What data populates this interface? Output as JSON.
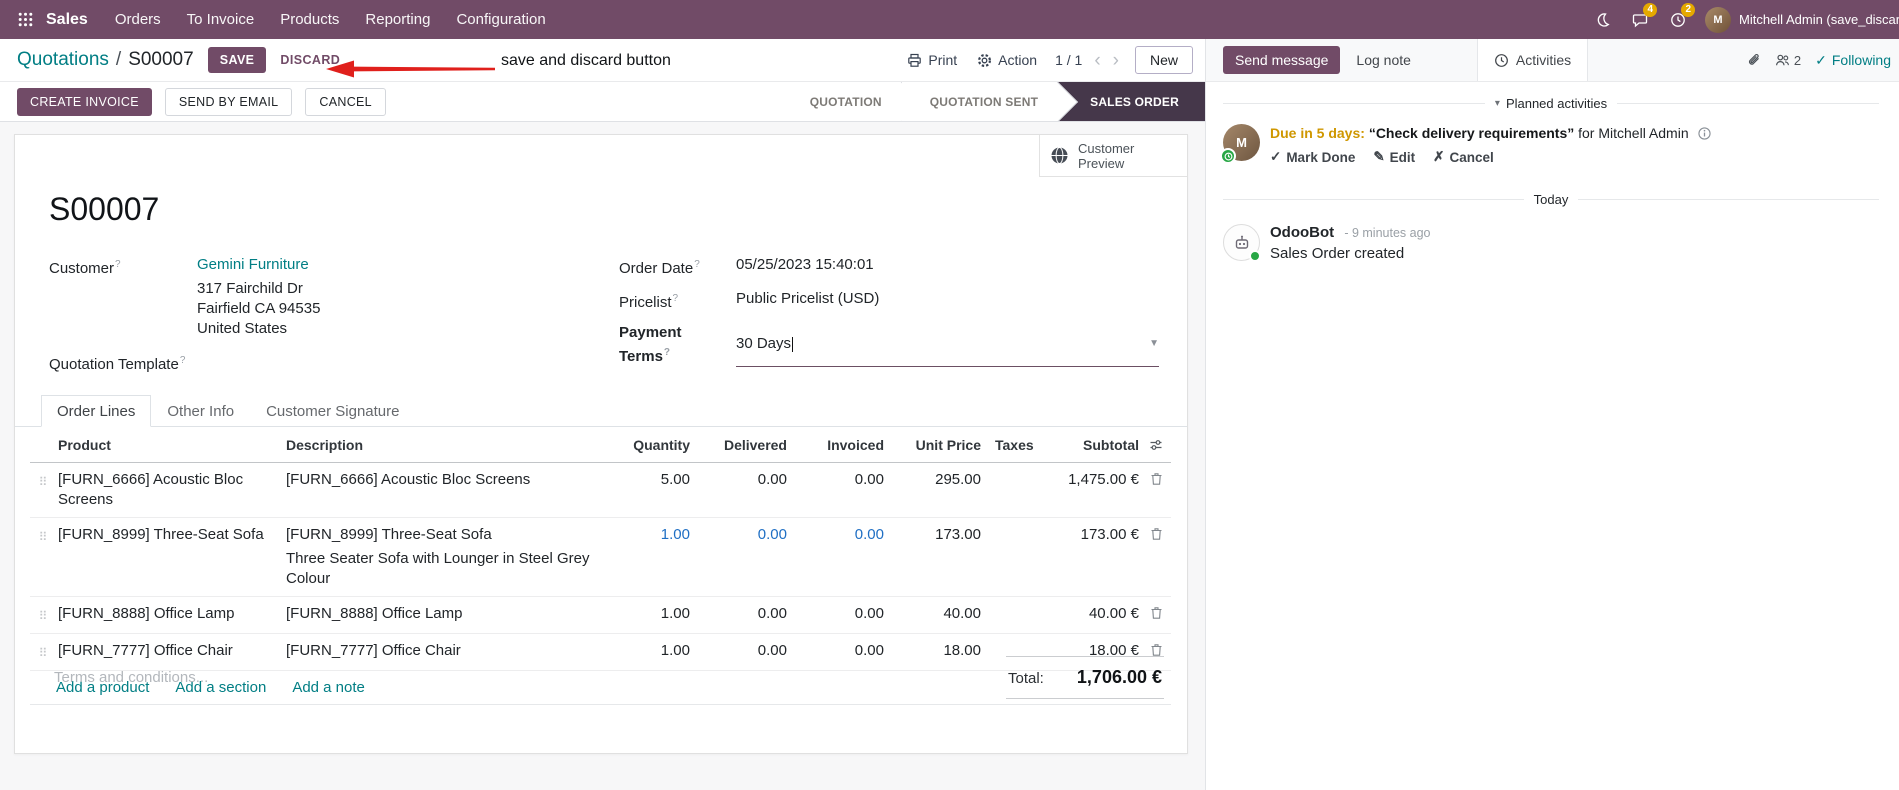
{
  "colors": {
    "primary": "#714B67",
    "link": "#017E84",
    "edited_value": "#1F6FC4",
    "stage_active_bg": "#45374A",
    "nav_badge": "#E4A900",
    "annotation_red": "#E0201C",
    "activity_due": "#CF9700",
    "online_green": "#28A745"
  },
  "icons": {
    "caret_down": "▾",
    "dropdown_arrow": "▼",
    "pager_prev": "‹",
    "pager_next": "›",
    "check": "✓",
    "pencil": "✎",
    "x_mark": "✗",
    "drag_handle": "⠿",
    "help_marker": "?"
  },
  "nav": {
    "app": "Sales",
    "menus": [
      "Orders",
      "To Invoice",
      "Products",
      "Reporting",
      "Configuration"
    ],
    "messages_badge": "4",
    "activities_badge": "2",
    "user_initial": "M",
    "user": "Mitchell Admin (save_discar"
  },
  "control": {
    "breadcrumb_parent": "Quotations",
    "breadcrumb_sep": "/",
    "breadcrumb_current": "S00007",
    "save": "SAVE",
    "discard": "DISCARD",
    "annotation": "save and discard button",
    "print": "Print",
    "action": "Action",
    "pager": "1 / 1",
    "new": "New"
  },
  "statusbar": {
    "create_invoice": "CREATE INVOICE",
    "send_by_email": "SEND BY EMAIL",
    "cancel": "CANCEL",
    "stages": [
      "QUOTATION",
      "QUOTATION SENT",
      "SALES ORDER"
    ],
    "active_stage": "SALES ORDER"
  },
  "sheet": {
    "customer_preview": "Customer Preview",
    "title": "S00007",
    "customer_label": "Customer",
    "customer_name": "Gemini Furniture",
    "address_line1": "317 Fairchild Dr",
    "address_line2": "Fairfield CA 94535",
    "address_line3": "United States",
    "quotation_template_label": "Quotation Template",
    "order_date_label": "Order Date",
    "order_date": "05/25/2023 15:40:01",
    "pricelist_label": "Pricelist",
    "pricelist": "Public Pricelist (USD)",
    "payment_terms_label": "Payment Terms",
    "payment_terms": "30 Days",
    "tabs": [
      "Order Lines",
      "Other Info",
      "Customer Signature"
    ]
  },
  "order_lines": {
    "columns": [
      "Product",
      "Description",
      "Quantity",
      "Delivered",
      "Invoiced",
      "Unit Price",
      "Taxes",
      "Subtotal"
    ],
    "rows": [
      {
        "product": "[FURN_6666] Acoustic Bloc Screens",
        "description": "[FURN_6666] Acoustic Bloc Screens",
        "description2": "",
        "quantity": "5.00",
        "delivered": "0.00",
        "invoiced": "0.00",
        "unit_price": "295.00",
        "taxes": "",
        "subtotal": "1,475.00 €"
      },
      {
        "product": "[FURN_8999] Three-Seat Sofa",
        "description": "[FURN_8999] Three-Seat Sofa",
        "description2": "Three Seater Sofa with Lounger in Steel Grey Colour",
        "quantity": "1.00",
        "delivered": "0.00",
        "invoiced": "0.00",
        "unit_price": "173.00",
        "taxes": "",
        "subtotal": "173.00 €"
      },
      {
        "product": "[FURN_8888] Office Lamp",
        "description": "[FURN_8888] Office Lamp",
        "description2": "",
        "quantity": "1.00",
        "delivered": "0.00",
        "invoiced": "0.00",
        "unit_price": "40.00",
        "taxes": "",
        "subtotal": "40.00 €"
      },
      {
        "product": "[FURN_7777] Office Chair",
        "description": "[FURN_7777] Office Chair",
        "description2": "",
        "quantity": "1.00",
        "delivered": "0.00",
        "invoiced": "0.00",
        "unit_price": "18.00",
        "taxes": "",
        "subtotal": "18.00 €"
      }
    ],
    "add_product": "Add a product",
    "add_section": "Add a section",
    "add_note": "Add a note",
    "terms_placeholder": "Terms and conditions...",
    "total_label": "Total:",
    "total_value": "1,706.00 €"
  },
  "chatter": {
    "send_message": "Send message",
    "log_note": "Log note",
    "activities": "Activities",
    "followers_count": "2",
    "following": "Following",
    "planned_activities": "Planned activities",
    "activity_due": "Due in 5 days:",
    "activity_summary": "“Check delivery requirements”",
    "activity_for": "for Mitchell Admin",
    "mark_done": "Mark Done",
    "edit": "Edit",
    "cancel": "Cancel",
    "today": "Today",
    "author": "OdooBot",
    "message_time": "- 9 minutes ago",
    "message_body": "Sales Order created"
  }
}
